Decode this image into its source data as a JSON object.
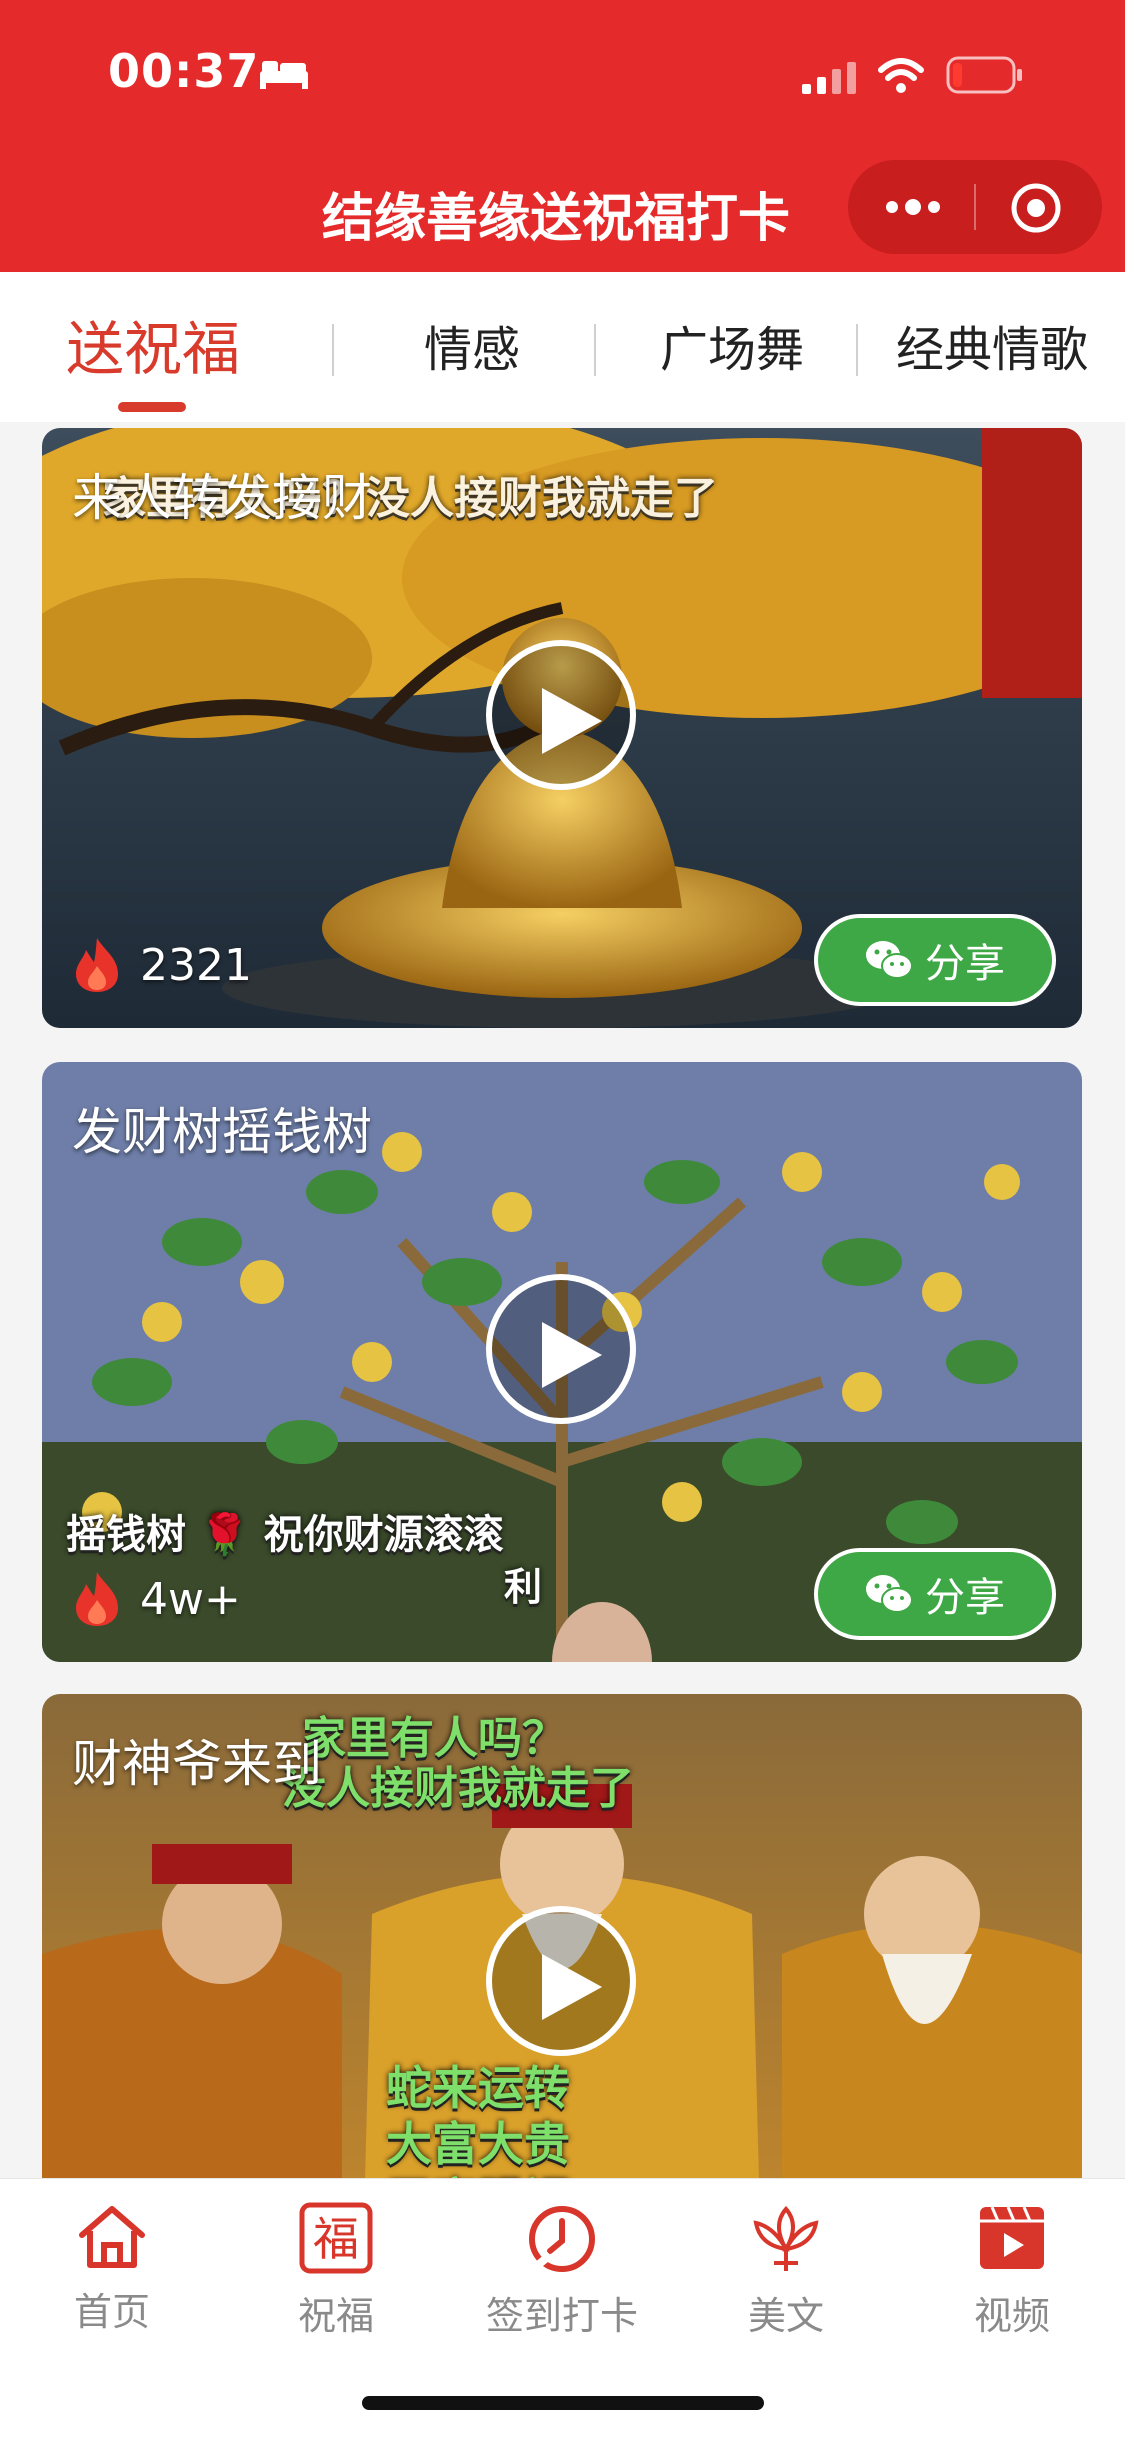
{
  "status_bar": {
    "time": "00:37"
  },
  "header": {
    "title": "结缘善缘送祝福打卡"
  },
  "tabs": [
    {
      "label": "送祝福",
      "active": true
    },
    {
      "label": "情感",
      "active": false
    },
    {
      "label": "广场舞",
      "active": false
    },
    {
      "label": "经典情歌",
      "active": false
    }
  ],
  "cards": [
    {
      "title": "来人转发接财",
      "views": "2321",
      "share_label": "分享",
      "overlay": "家里有人吗？没人接财我就走了"
    },
    {
      "title": "发财树摇钱树",
      "views": "4w+",
      "share_label": "分享",
      "overlay": "摇钱树 🌹 祝你财源滚滚",
      "overlay2": "利"
    },
    {
      "title": "财神爷来到",
      "overlay": "家里有人吗？",
      "overlay2": "没人接财我就走了",
      "overlay3": "蛇来运转",
      "overlay4": "大富大贵",
      "overlay5": "天官赐福"
    }
  ],
  "bottom_nav": [
    {
      "label": "首页",
      "icon": "home-icon"
    },
    {
      "label": "祝福",
      "icon": "fu-icon",
      "glyph": "福"
    },
    {
      "label": "签到打卡",
      "icon": "clock-icon"
    },
    {
      "label": "美文",
      "icon": "lotus-icon"
    },
    {
      "label": "视频",
      "icon": "video-icon"
    }
  ],
  "colors": {
    "brand_red": "#e42a2a",
    "active_tab": "#d83a2b",
    "share_green": "#3fa846"
  }
}
